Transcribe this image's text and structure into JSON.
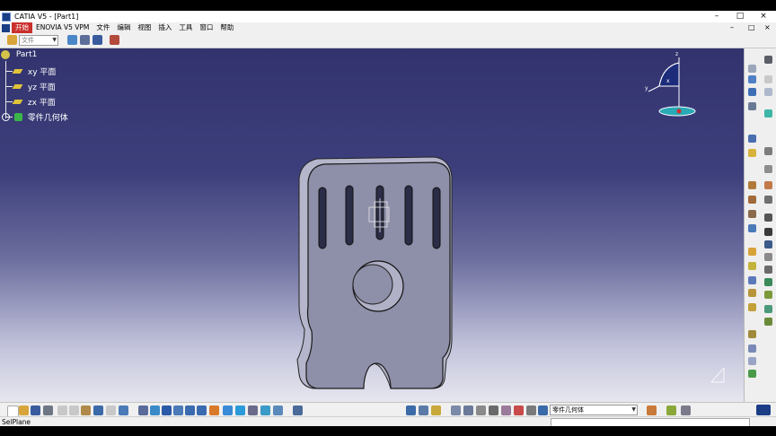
{
  "window": {
    "title": "CATIA V5 - [Part1]",
    "minimize": "–",
    "restore": "□",
    "close": "×"
  },
  "menu": {
    "items": [
      "开始",
      "ENOVIA V5 VPM",
      "文件",
      "编辑",
      "视图",
      "插入",
      "工具",
      "窗口",
      "帮助"
    ],
    "doc_controls": {
      "minimize": "–",
      "restore": "□",
      "close": "×"
    }
  },
  "toolbar_top": {
    "workbench_combo": "文件"
  },
  "tree": {
    "root": "Part1",
    "children": [
      "xy 平面",
      "yz 平面",
      "zx 平面",
      "零件几何体"
    ]
  },
  "compass": {
    "x_label": "x",
    "y_label": "y",
    "z_label": "z"
  },
  "bottom_toolbar": {
    "body_combo": "零件几何体"
  },
  "status": {
    "text": "SelPlane"
  },
  "colors": {
    "active_menu": "#c9302c",
    "part_face": "#8e8fa9",
    "background_top": "#32336e"
  }
}
